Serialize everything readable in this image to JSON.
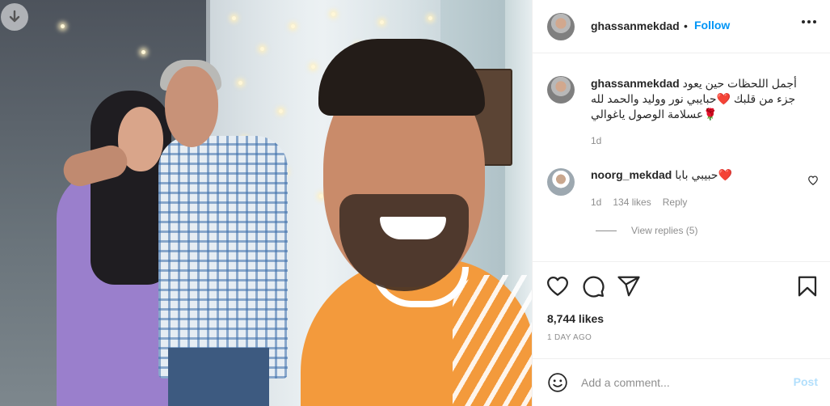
{
  "post": {
    "username": "ghassanmekdad",
    "separator": "•",
    "follow_label": "Follow",
    "more_icon": "more-horizontal-icon",
    "download_icon": "download-arrow-icon"
  },
  "caption": {
    "username": "ghassanmekdad",
    "line1": "أجمل اللحظات حين يعود",
    "line2": "جزء من قلبك ❤️حبايبي نور ووليد والحمد لله",
    "line3": "🌹عسلامة الوصول ياغوالي",
    "time": "1d"
  },
  "comment": {
    "username": "noorg_mekdad",
    "text": "حبيبي بابا❤️",
    "time": "1d",
    "likes": "134 likes",
    "reply_label": "Reply",
    "view_replies": "View replies (5)"
  },
  "actions": {
    "like_icon": "heart-icon",
    "comment_icon": "comment-icon",
    "share_icon": "send-icon",
    "save_icon": "bookmark-icon"
  },
  "likes_count": "8,744 likes",
  "post_time": "1 DAY AGO",
  "add_comment": {
    "placeholder": "Add a comment...",
    "post_label": "Post",
    "emoji_icon": "emoji-smile-icon"
  },
  "colors": {
    "link_blue": "#0095f6",
    "post_disabled": "#b2dffc",
    "muted_text": "#8e8e8e"
  }
}
